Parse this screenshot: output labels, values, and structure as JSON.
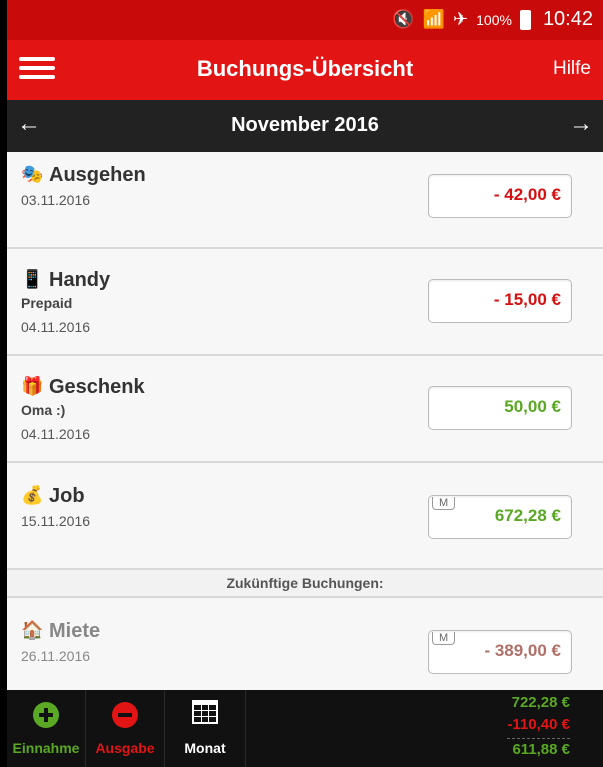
{
  "status_bar": {
    "battery": "100%",
    "time": "10:42",
    "icons": [
      "mute-icon",
      "wifi-icon",
      "airplane-icon",
      "battery-icon"
    ]
  },
  "app_bar": {
    "title": "Buchungs-Übersicht",
    "help_label": "Hilfe"
  },
  "month_bar": {
    "title": "November 2016",
    "prev_icon": "←",
    "next_icon": "→"
  },
  "transactions": [
    {
      "icon": "🎭",
      "name": "Ausgehen",
      "note": "",
      "date": "03.11.2016",
      "amount": "- 42,00 €",
      "type": "expense"
    },
    {
      "icon": "📱",
      "name": "Handy",
      "note": "Prepaid",
      "date": "04.11.2016",
      "amount": "- 15,00 €",
      "type": "expense"
    },
    {
      "icon": "🎁",
      "name": "Geschenk",
      "note": "Oma :)",
      "date": "04.11.2016",
      "amount": "50,00 €",
      "type": "income"
    },
    {
      "icon": "💰",
      "name": "Job",
      "note": "",
      "date": "15.11.2016",
      "amount": "672,28 €",
      "type": "income",
      "badge": "M"
    }
  ],
  "future_header": "Zukünftige Buchungen:",
  "future_transactions": [
    {
      "icon": "🏠",
      "name": "Miete",
      "date": "26.11.2016",
      "amount": "- 389,00 €",
      "badge": "M"
    }
  ],
  "bottom_bar": {
    "income_label": "Einnahme",
    "expense_label": "Ausgabe",
    "month_label": "Monat",
    "total_income": "722,28 €",
    "total_expense": "-110,40 €",
    "balance": "611,88 €"
  },
  "colors": {
    "red": "#e31414",
    "expense": "#d41010",
    "income": "#5aa823",
    "future_expense": "#b07068"
  }
}
